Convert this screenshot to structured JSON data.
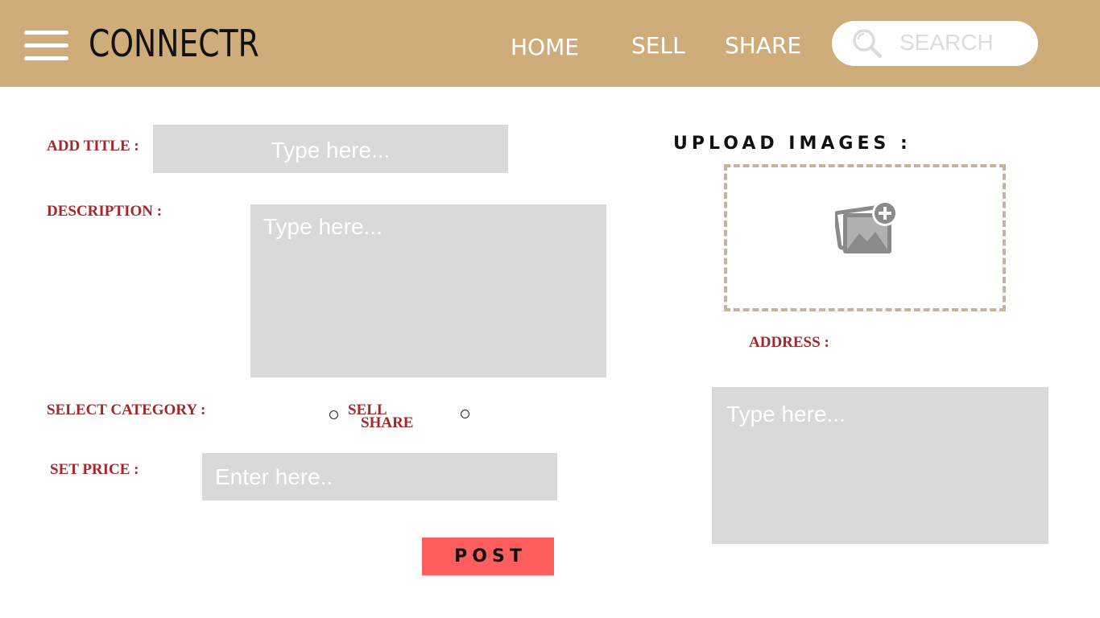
{
  "header": {
    "logo": "CONNECTR",
    "menu_icon": "hamburger-menu-icon",
    "nav": {
      "home": "HOME",
      "sell": "SELL",
      "share": "SHARE"
    },
    "search": {
      "icon": "search-icon",
      "placeholder": "SEARCH"
    }
  },
  "form": {
    "title": {
      "label": "ADD TITLE :",
      "placeholder": "Type here..."
    },
    "description": {
      "label": "DESCRIPTION :",
      "placeholder": "Type here..."
    },
    "category": {
      "label": "SELECT CATEGORY :",
      "options": [
        "SELL",
        "SHARE"
      ]
    },
    "price": {
      "label": "SET PRICE :",
      "placeholder": "Enter here.."
    },
    "post_label": "POST"
  },
  "upload": {
    "label": "UPLOAD IMAGES :",
    "icon": "add-image-icon"
  },
  "address": {
    "label": "ADDRESS :",
    "placeholder": "Type here..."
  },
  "colors": {
    "header_bg": "#cead7a",
    "label": "#a3282b",
    "field_bg": "#d9d9d9",
    "post_button": "#ff5e5e",
    "upload_border": "#c7b39a"
  }
}
